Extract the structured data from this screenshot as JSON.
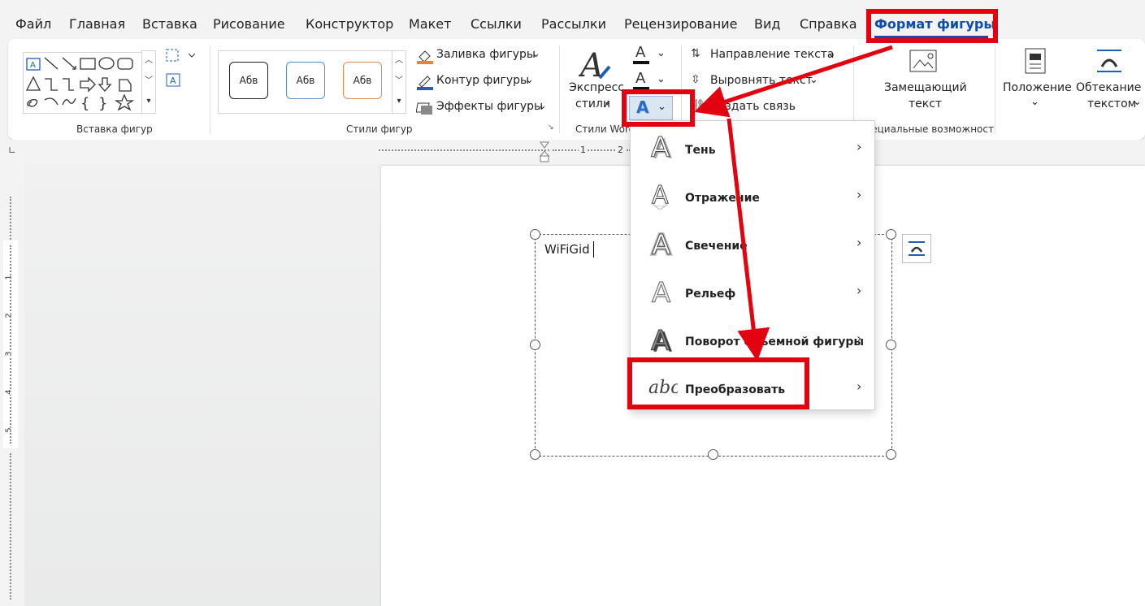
{
  "menu_tabs": [
    "Файл",
    "Главная",
    "Вставка",
    "Рисование",
    "Конструктор",
    "Макет",
    "Ссылки",
    "Рассылки",
    "Рецензирование",
    "Вид",
    "Справка",
    "Формат фигуры"
  ],
  "ribbon": {
    "insert_shapes": {
      "group_label": "Вставка фигур"
    },
    "shape_styles": {
      "group_label": "Стили фигур",
      "gallery": [
        "Абв",
        "Абв",
        "Абв"
      ],
      "fill": "Заливка фигуры",
      "outline": "Контур фигуры",
      "effects": "Эффекты фигуры"
    },
    "wordart": {
      "express_line1": "Экспресс",
      "express_line2": "стили",
      "group_label": "Стили Word",
      "text_fill_glyph": "A",
      "text_outline_glyph": "A",
      "text_effects_glyph": "A"
    },
    "text": {
      "direction": "Направление текста",
      "align": "Выровнять текст",
      "link": "Создать связь"
    },
    "accessibility": {
      "alt_text_line1": "Замещающий",
      "alt_text_line2": "текст",
      "group_label": "Специальные возможности"
    },
    "arrange": {
      "position": "Положение",
      "wrap_line1": "Обтекание",
      "wrap_line2": "текстом"
    }
  },
  "ruler": {
    "marks": [
      "1",
      "2"
    ],
    "vmarks": [
      "1",
      "2",
      "3",
      "4",
      "5"
    ]
  },
  "document": {
    "textbox_text": "WiFiGid"
  },
  "dropdown": {
    "items": [
      {
        "label": "Тень",
        "icon": "shadow-a-icon"
      },
      {
        "label": "Отражение",
        "icon": "reflection-a-icon"
      },
      {
        "label": "Свечение",
        "icon": "glow-a-icon"
      },
      {
        "label": "Рельеф",
        "icon": "bevel-a-icon"
      },
      {
        "label": "Поворот объемной фигуры",
        "icon": "3d-rotation-a-icon"
      },
      {
        "label": "Преобразовать",
        "icon": "transform-abc-icon"
      }
    ]
  },
  "annotation_color": "#e3020f",
  "accent_color": "#0f4ea8"
}
